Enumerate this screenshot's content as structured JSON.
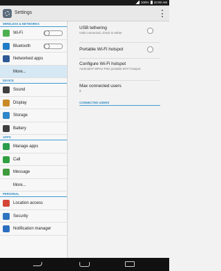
{
  "status_bar": {
    "battery": "100%",
    "time": "10:00 AM"
  },
  "app_bar": {
    "title": "Settings"
  },
  "left_pane": {
    "sections": {
      "wireless": "WIRELESS & NETWORKS",
      "device": "DEVICE",
      "apps": "APPS",
      "personal": "PERSONAL"
    },
    "items": {
      "wifi": "Wi-Fi",
      "bluetooth": "Bluetooth",
      "networked_apps": "Networked apps",
      "more_wireless": "More...",
      "sound": "Sound",
      "display": "Display",
      "storage": "Storage",
      "battery": "Battery",
      "manage_apps": "Manage apps",
      "call": "Call",
      "message": "Message",
      "more_apps": "More...",
      "location": "Location access",
      "security": "Security",
      "notification": "Notification manager"
    }
  },
  "right_pane": {
    "usb": {
      "title": "USB tethering",
      "sub": "USB connected, check to tether"
    },
    "hotspot": {
      "title": "Portable Wi-Fi hotspot"
    },
    "configure": {
      "title": "Configure Wi-Fi hotspot",
      "sub": "AndroidAP WPA2 PSK portable Wi-Fi hotspot"
    },
    "max": {
      "title": "Max connected users",
      "value": "8"
    },
    "connected_section": "CONNECTED USERS"
  },
  "colors": {
    "accent": "#2d8bc4",
    "selected_bg": "#d5e8f4"
  },
  "icons": [
    "signal-icon",
    "battery-icon",
    "settings-gear-icon",
    "overflow-menu-icon",
    "wifi-icon",
    "bluetooth-icon",
    "back-icon",
    "home-icon",
    "recent-apps-icon"
  ]
}
